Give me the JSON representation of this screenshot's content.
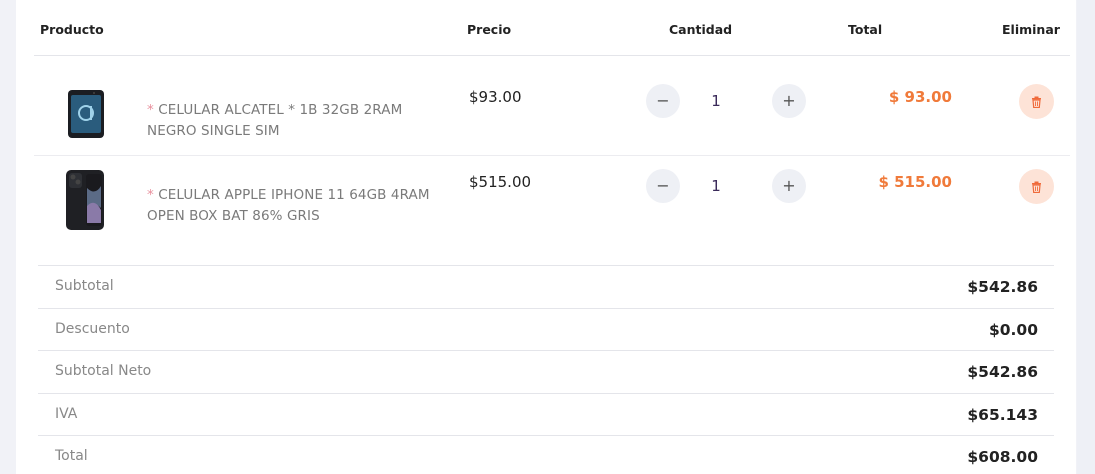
{
  "headers": {
    "producto": "Producto",
    "precio": "Precio",
    "cantidad": "Cantidad",
    "total": "Total",
    "eliminar": "Eliminar"
  },
  "items": [
    {
      "name_prefix": "*",
      "name": "CELULAR ALCATEL * 1B 32GB 2RAM NEGRO SINGLE SIM",
      "price": "$93.00",
      "qty": "1",
      "total": "$ 93.00",
      "thumb_icon": "phone-image"
    },
    {
      "name_prefix": "*",
      "name": "CELULAR APPLE IPHONE 11 64GB 4RAM OPEN BOX BAT 86% GRIS",
      "price": "$515.00",
      "qty": "1",
      "total": "$ 515.00",
      "thumb_icon": "phone-image"
    }
  ],
  "controls": {
    "minus": "−",
    "plus": "+",
    "delete_icon": "trash-icon"
  },
  "summary": [
    {
      "label": "Subtotal",
      "value": "$542.86"
    },
    {
      "label": "Descuento",
      "value": "$0.00"
    },
    {
      "label": "Subtotal Neto",
      "value": "$542.86"
    },
    {
      "label": "IVA",
      "value": "$65.143"
    },
    {
      "label": "Total",
      "value": "$608.00"
    }
  ],
  "colors": {
    "accent_total": "#f07a3a",
    "delete_bg": "#fde3d7",
    "delete_icon": "#f06a3a",
    "asterisk": "#e88f9c"
  }
}
